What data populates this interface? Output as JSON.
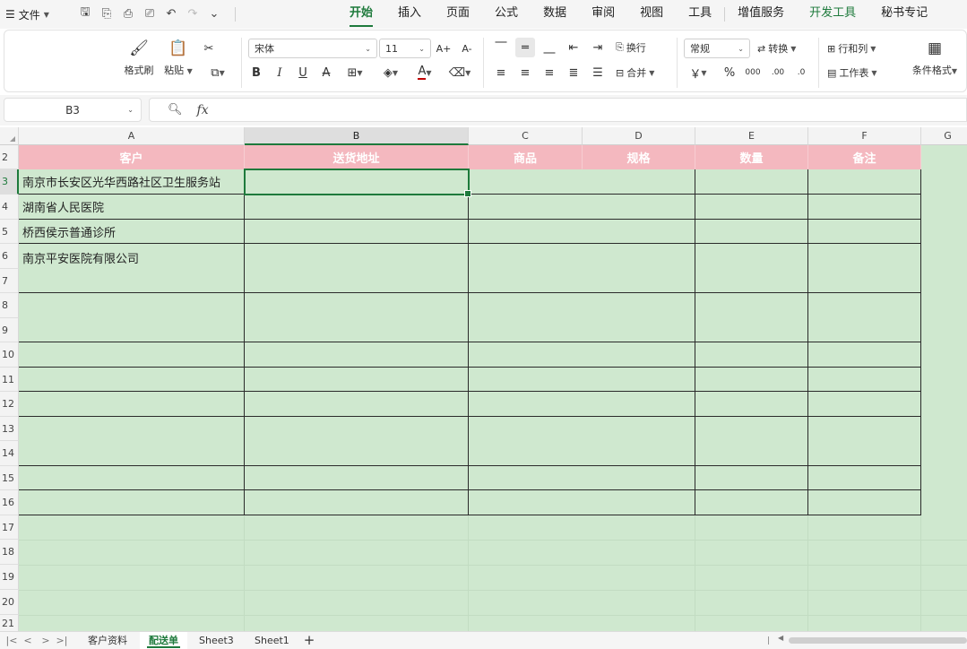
{
  "menubar": {
    "file_icon": "hamburger-icon",
    "file_label": "文件",
    "quick_icons": [
      "save-icon",
      "save-as-icon",
      "print-icon",
      "print-preview-icon",
      "undo-icon",
      "redo-icon",
      "more-icon"
    ],
    "tabs": [
      "开始",
      "插入",
      "页面",
      "公式",
      "数据",
      "审阅",
      "视图",
      "工具",
      "增值服务",
      "开发工具",
      "秘书专记"
    ],
    "active_tab": "开始"
  },
  "ribbon": {
    "format_painter": "格式刷",
    "paste": "粘贴",
    "font_name": "宋体",
    "font_size": "11",
    "wrap": "换行",
    "merge": "合并",
    "number_format": "常规",
    "convert": "转换",
    "rows_cols": "行和列",
    "worksheet": "工作表",
    "cond_format": "条件格式",
    "bold": "B",
    "italic": "I",
    "underline": "U",
    "strike": "A",
    "font_color_glyph": "A",
    "currency": "￥",
    "percent": "%",
    "thousands": "000",
    "dec_inc": ".00",
    "dec_dec": ".0",
    "grow_font": "A+",
    "shrink_font": "A-"
  },
  "formula": {
    "name_box": "B3",
    "fx_label": "fx",
    "content": ""
  },
  "sheet": {
    "columns": [
      "A",
      "B",
      "C",
      "D",
      "E",
      "F",
      "G"
    ],
    "rows": [
      "2",
      "3",
      "4",
      "5",
      "6",
      "7",
      "8",
      "9",
      "10",
      "11",
      "12",
      "13",
      "14",
      "15",
      "16",
      "17",
      "18",
      "19",
      "20",
      "21"
    ],
    "headers": {
      "customer": "客户",
      "address": "送货地址",
      "product": "商品",
      "spec": "规格",
      "qty": "数量",
      "remark": "备注"
    },
    "customers": [
      "南京市长安区光华西路社区卫生服务站",
      "湖南省人民医院",
      "桥西侯示普通诊所",
      "南京平安医院有限公司"
    ]
  },
  "sheet_tabs": {
    "tabs": [
      "客户资料",
      "配送单",
      "Sheet3",
      "Sheet1"
    ],
    "active": "配送单",
    "add_label": "+"
  }
}
